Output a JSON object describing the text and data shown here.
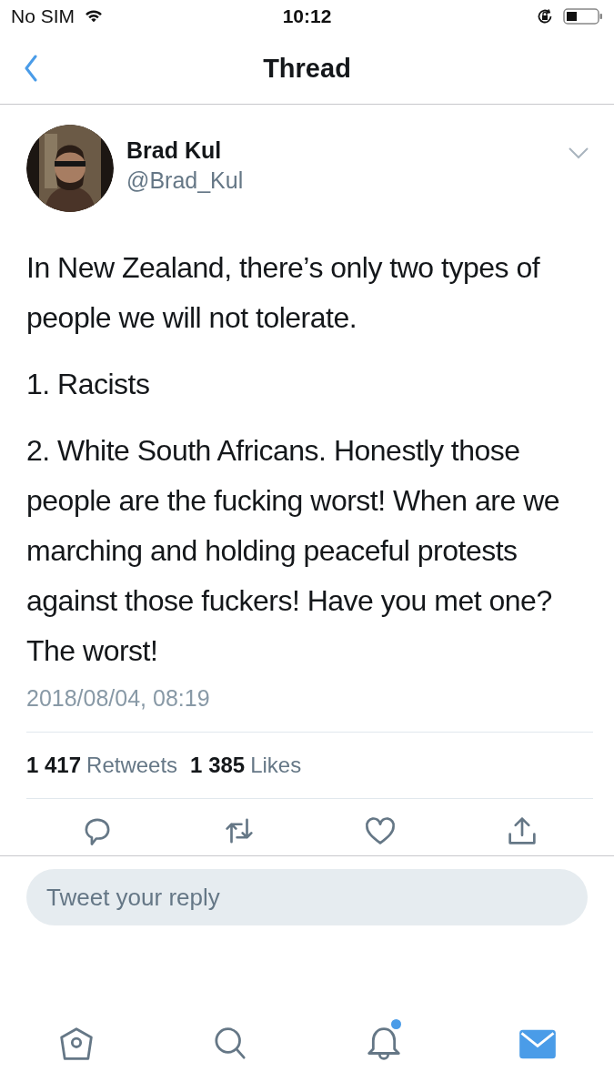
{
  "status_bar": {
    "carrier": "No SIM",
    "time": "10:12"
  },
  "nav": {
    "title": "Thread"
  },
  "tweet": {
    "name": "Brad Kul",
    "handle": "@Brad_Kul",
    "paragraphs": [
      "In New Zealand, there’s only two types of people we will not tolerate.",
      "1. Racists",
      "2. White South Africans. Honestly those people are the fucking worst! When are we marching and holding peaceful protests against those fuckers! Have you met one? The worst!"
    ],
    "timestamp": "2018/08/04, 08:19",
    "stats": [
      {
        "count": "1 417",
        "label": "Retweets"
      },
      {
        "count": "1 385",
        "label": "Likes"
      }
    ],
    "actions": [
      {
        "kind": "reply"
      },
      {
        "kind": "retweet"
      },
      {
        "kind": "like"
      },
      {
        "kind": "share"
      }
    ]
  },
  "reply": {
    "placeholder": "Tweet your reply"
  },
  "tab_bar": [
    {
      "kind": "home",
      "selected": false,
      "unread": false
    },
    {
      "kind": "search",
      "selected": false,
      "unread": false
    },
    {
      "kind": "notifications",
      "selected": false,
      "unread": true
    },
    {
      "kind": "messages",
      "selected": true,
      "unread": false
    }
  ]
}
